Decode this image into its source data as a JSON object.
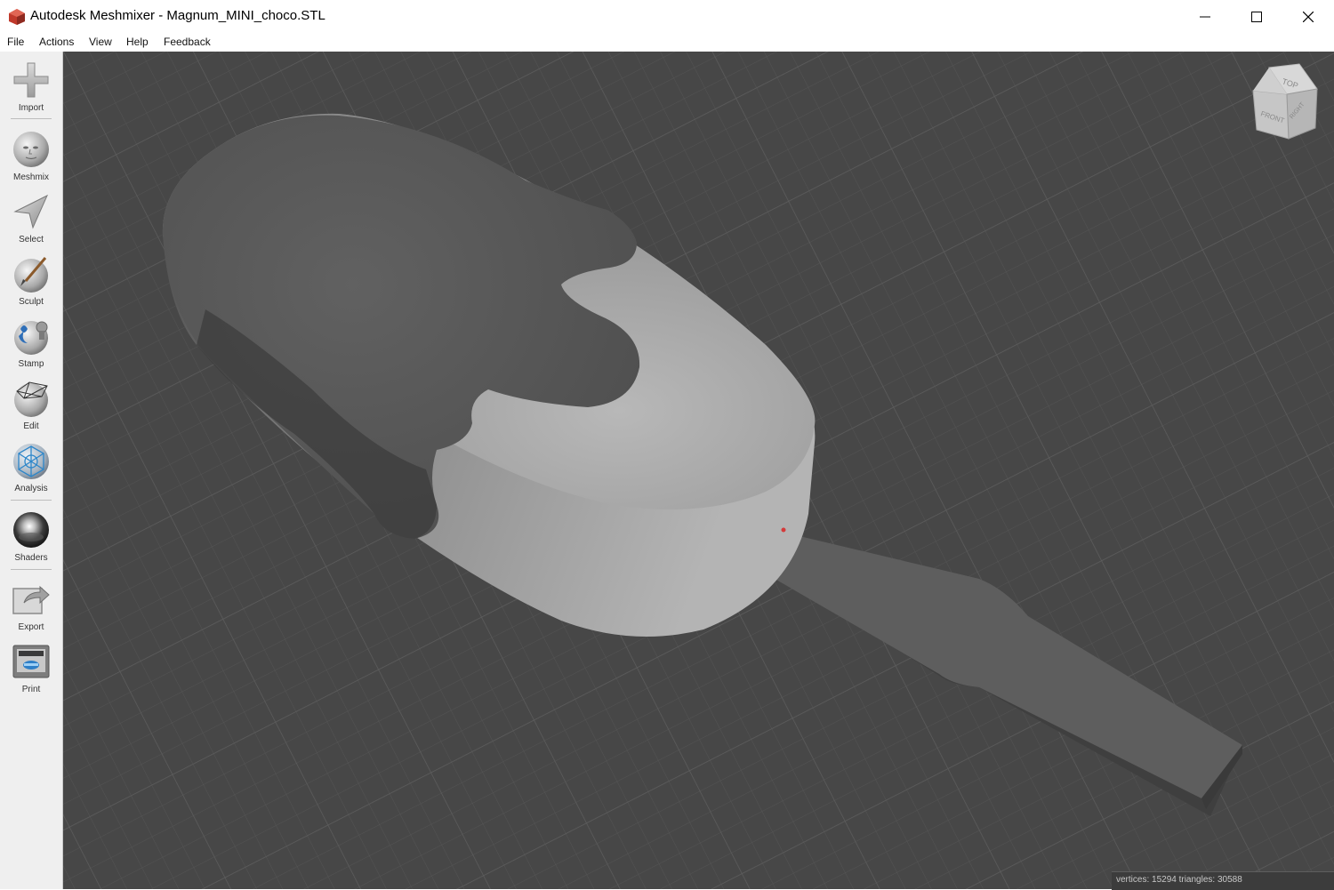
{
  "window": {
    "title": "Autodesk Meshmixer - Magnum_MINI_choco.STL",
    "controls": {
      "minimize_icon": "minimize-icon",
      "maximize_icon": "maximize-icon",
      "close_icon": "close-icon"
    }
  },
  "menu": [
    {
      "label": "File"
    },
    {
      "label": "Actions"
    },
    {
      "label": "View"
    },
    {
      "label": "Help"
    },
    {
      "label": "Feedback"
    }
  ],
  "tools": [
    {
      "label": "Import",
      "icon": "plus-icon"
    },
    {
      "label": "Meshmix",
      "icon": "face-sphere-icon"
    },
    {
      "label": "Select",
      "icon": "arrow-cursor-icon"
    },
    {
      "label": "Sculpt",
      "icon": "brush-sphere-icon"
    },
    {
      "label": "Stamp",
      "icon": "stamp-sphere-icon"
    },
    {
      "label": "Edit",
      "icon": "wireframe-sphere-icon"
    },
    {
      "label": "Analysis",
      "icon": "mesh-sphere-icon"
    },
    {
      "label": "Shaders",
      "icon": "chrome-sphere-icon"
    },
    {
      "label": "Export",
      "icon": "export-icon"
    },
    {
      "label": "Print",
      "icon": "printer-icon"
    }
  ],
  "viewcube": {
    "top": "TOP",
    "front": "FRONT",
    "right": "RIGHT"
  },
  "status": {
    "text": "vertices: 15294 triangles: 30588"
  },
  "colors": {
    "viewport_bg": "#474747",
    "grid": "#555555",
    "chocolate": "#5a5a5a",
    "ice_cream": "#a8a8a8",
    "stick": "#5e5e5e"
  }
}
